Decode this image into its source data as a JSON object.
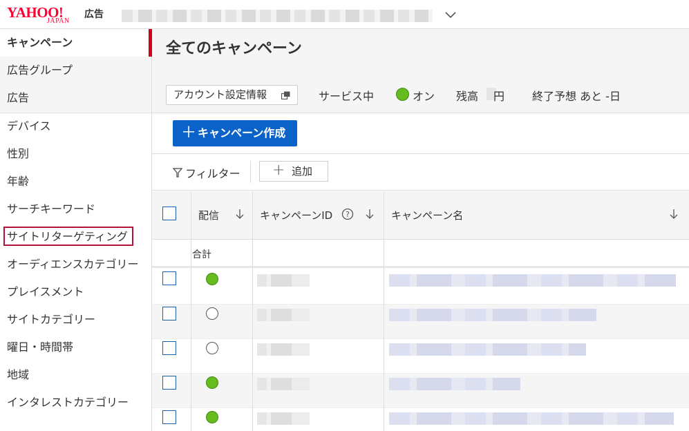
{
  "header": {
    "logo_main": "YAHOO!",
    "logo_sub": "JAPAN",
    "logo_product": "広告"
  },
  "sidebar": {
    "items": [
      {
        "label": "キャンペーン",
        "active": true
      },
      {
        "label": "広告グループ"
      },
      {
        "label": "広告"
      },
      {
        "label": "デバイス"
      },
      {
        "label": "性別"
      },
      {
        "label": "年齢"
      },
      {
        "label": "サーチキーワード"
      },
      {
        "label": "サイトリターゲティング",
        "highlighted": true
      },
      {
        "label": "オーディエンスカテゴリー"
      },
      {
        "label": "プレイスメント"
      },
      {
        "label": "サイトカテゴリー"
      },
      {
        "label": "曜日・時間帯"
      },
      {
        "label": "地域"
      },
      {
        "label": "インタレストカテゴリー"
      }
    ]
  },
  "main": {
    "title": "全てのキャンペーン",
    "account_settings_label": "アカウント設定情報",
    "service_label": "サービス中",
    "service_status": "オン",
    "balance_label": "残高",
    "balance_unit": "円",
    "end_forecast": "終了予想 あと -日",
    "create_button": "キャンペーン作成",
    "filter_label": "フィルター",
    "add_label": "追加"
  },
  "table": {
    "columns": [
      "配信",
      "キャンペーンID",
      "キャンペーン名"
    ],
    "total_label": "合計",
    "rows": [
      {
        "status": "on"
      },
      {
        "status": "off"
      },
      {
        "status": "off"
      },
      {
        "status": "on"
      },
      {
        "status": "on"
      }
    ]
  },
  "colors": {
    "brand_red": "#ff0033",
    "active_marker": "#d0021b",
    "primary_button": "#0b63c9",
    "status_on": "#66bb1e"
  }
}
